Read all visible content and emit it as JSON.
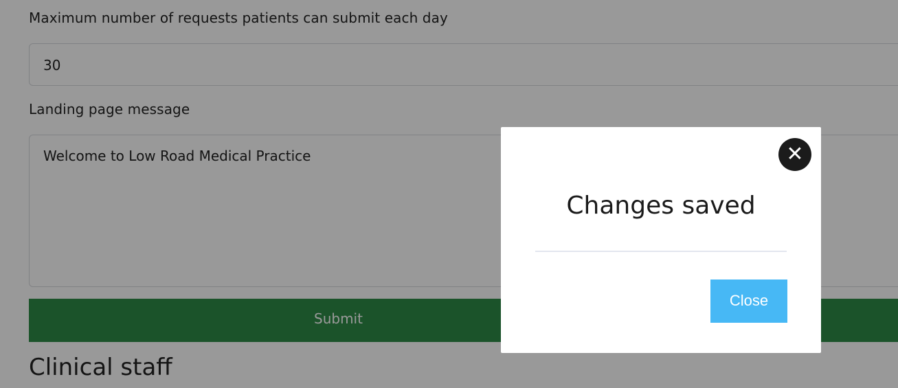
{
  "form": {
    "max_requests_label": "Maximum number of requests patients can submit each day",
    "max_requests_value": "30",
    "landing_message_label": "Landing page message",
    "landing_message_value": "Welcome to Low Road Medical Practice",
    "submit_label": "Submit"
  },
  "section": {
    "clinical_staff_title": "Clinical staff"
  },
  "modal": {
    "close_icon": "close-icon",
    "close_glyph": "✕",
    "title": "Changes saved",
    "close_button_label": "Close"
  },
  "colors": {
    "submit_green": "#2e8b46",
    "close_blue": "#47b8f5",
    "overlay": "rgba(0,0,0,0.4)"
  }
}
